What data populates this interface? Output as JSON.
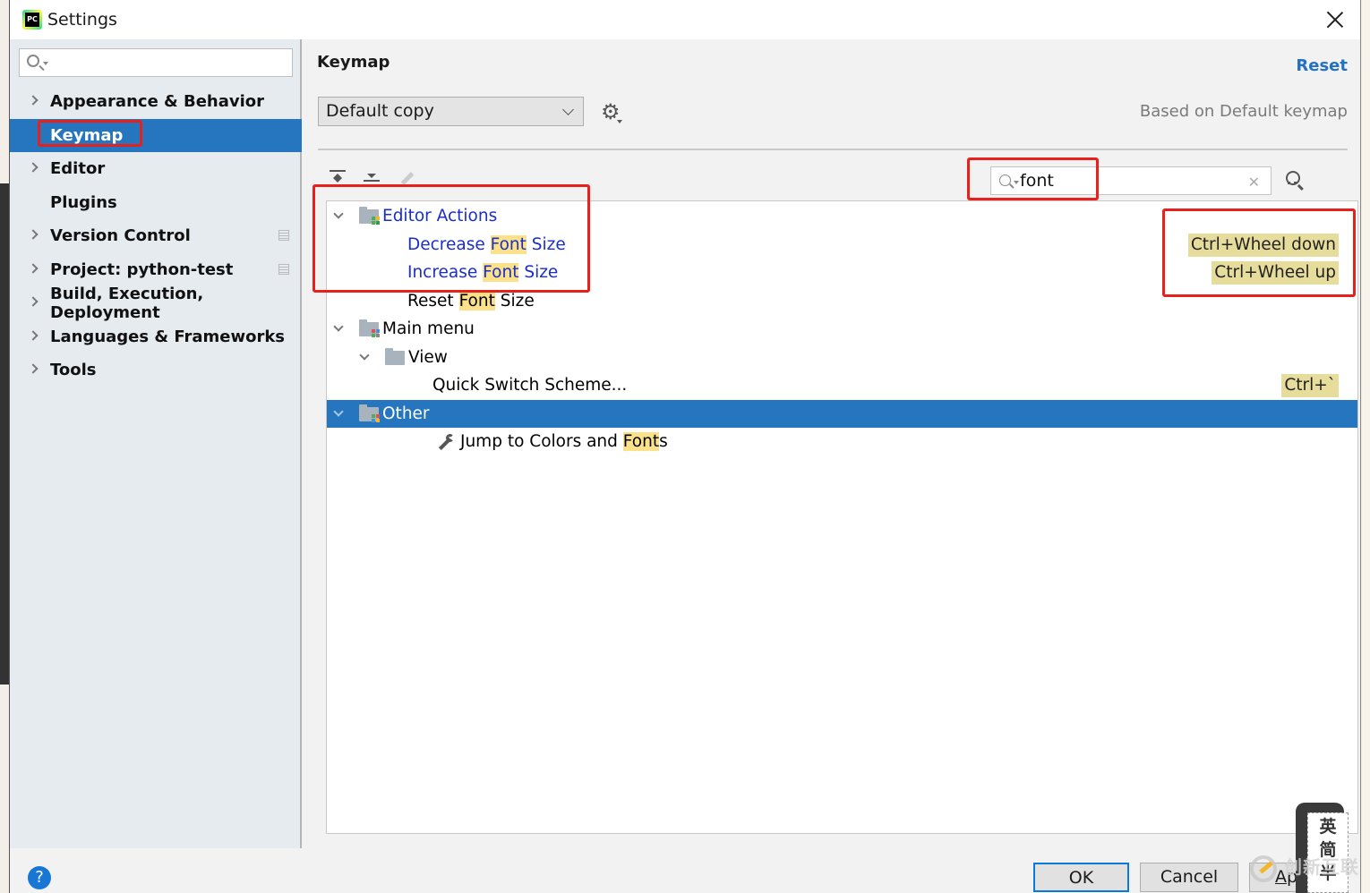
{
  "window": {
    "title": "Settings",
    "app_icon": "pycharm-icon",
    "close_icon": "close-icon"
  },
  "sidebar": {
    "search": {
      "value": "",
      "placeholder": ""
    },
    "items": [
      {
        "label": "Appearance & Behavior",
        "expandable": true,
        "selected": false,
        "project_icon": false
      },
      {
        "label": "Keymap",
        "expandable": false,
        "selected": true,
        "project_icon": false
      },
      {
        "label": "Editor",
        "expandable": true,
        "selected": false,
        "project_icon": false
      },
      {
        "label": "Plugins",
        "expandable": false,
        "selected": false,
        "project_icon": false
      },
      {
        "label": "Version Control",
        "expandable": true,
        "selected": false,
        "project_icon": true
      },
      {
        "label": "Project: python-test",
        "expandable": true,
        "selected": false,
        "project_icon": true
      },
      {
        "label": "Build, Execution, Deployment",
        "expandable": true,
        "selected": false,
        "project_icon": false
      },
      {
        "label": "Languages & Frameworks",
        "expandable": true,
        "selected": false,
        "project_icon": false
      },
      {
        "label": "Tools",
        "expandable": true,
        "selected": false,
        "project_icon": false
      }
    ]
  },
  "main": {
    "title": "Keymap",
    "reset_label": "Reset",
    "keymap_select": {
      "value": "Default copy"
    },
    "based_on": "Based on Default keymap",
    "toolbar": {
      "expand_all": "expand-all-icon",
      "collapse_all": "collapse-all-icon",
      "edit": "edit-icon"
    },
    "search": {
      "value": "font",
      "placeholder": ""
    },
    "tree": [
      {
        "level": 0,
        "expanded": true,
        "icon": "editor-actions-folder-icon",
        "pre": "Editor Actions",
        "hl": "",
        "post": "",
        "style": "blue",
        "shortcut": ""
      },
      {
        "level": 2,
        "expanded": null,
        "icon": "",
        "pre": "Decrease ",
        "hl": "Font",
        "post": " Size",
        "style": "blue",
        "shortcut": "Ctrl+Wheel down"
      },
      {
        "level": 2,
        "expanded": null,
        "icon": "",
        "pre": "Increase ",
        "hl": "Font",
        "post": " Size",
        "style": "blue",
        "shortcut": "Ctrl+Wheel up"
      },
      {
        "level": 2,
        "expanded": null,
        "icon": "",
        "pre": "Reset ",
        "hl": "Font",
        "post": " Size",
        "style": "normal",
        "shortcut": ""
      },
      {
        "level": 0,
        "expanded": true,
        "icon": "main-menu-folder-icon",
        "pre": "Main menu",
        "hl": "",
        "post": "",
        "style": "normal",
        "shortcut": ""
      },
      {
        "level": 1,
        "expanded": true,
        "icon": "folder-icon",
        "pre": "View",
        "hl": "",
        "post": "",
        "style": "normal",
        "shortcut": ""
      },
      {
        "level": 3,
        "expanded": null,
        "icon": "",
        "pre": "Quick Switch Scheme...",
        "hl": "",
        "post": "",
        "style": "normal",
        "shortcut": "Ctrl+`"
      },
      {
        "level": 0,
        "expanded": true,
        "icon": "other-folder-icon",
        "pre": "Other",
        "hl": "",
        "post": "",
        "style": "selected",
        "shortcut": ""
      },
      {
        "level": 2,
        "expanded": null,
        "icon": "wrench-icon",
        "pre": "Jump to Colors and ",
        "hl": "Font",
        "post": "s",
        "style": "normal",
        "shortcut": ""
      }
    ]
  },
  "footer": {
    "help_label": "?",
    "ok_label": "OK",
    "cancel_label": "Cancel",
    "apply_mnemonic": "A",
    "apply_rest": "pp"
  },
  "overlay": {
    "ime_chars": [
      "英",
      "简",
      "半"
    ],
    "watermark": "创新互联"
  },
  "colors": {
    "selection": "#2675bf",
    "highlight": "#fbe28a",
    "shortcut_bg": "#e6dc9c",
    "annotation": "#e8201c",
    "link": "#2470c2",
    "action_blue": "#1a2ec8"
  }
}
